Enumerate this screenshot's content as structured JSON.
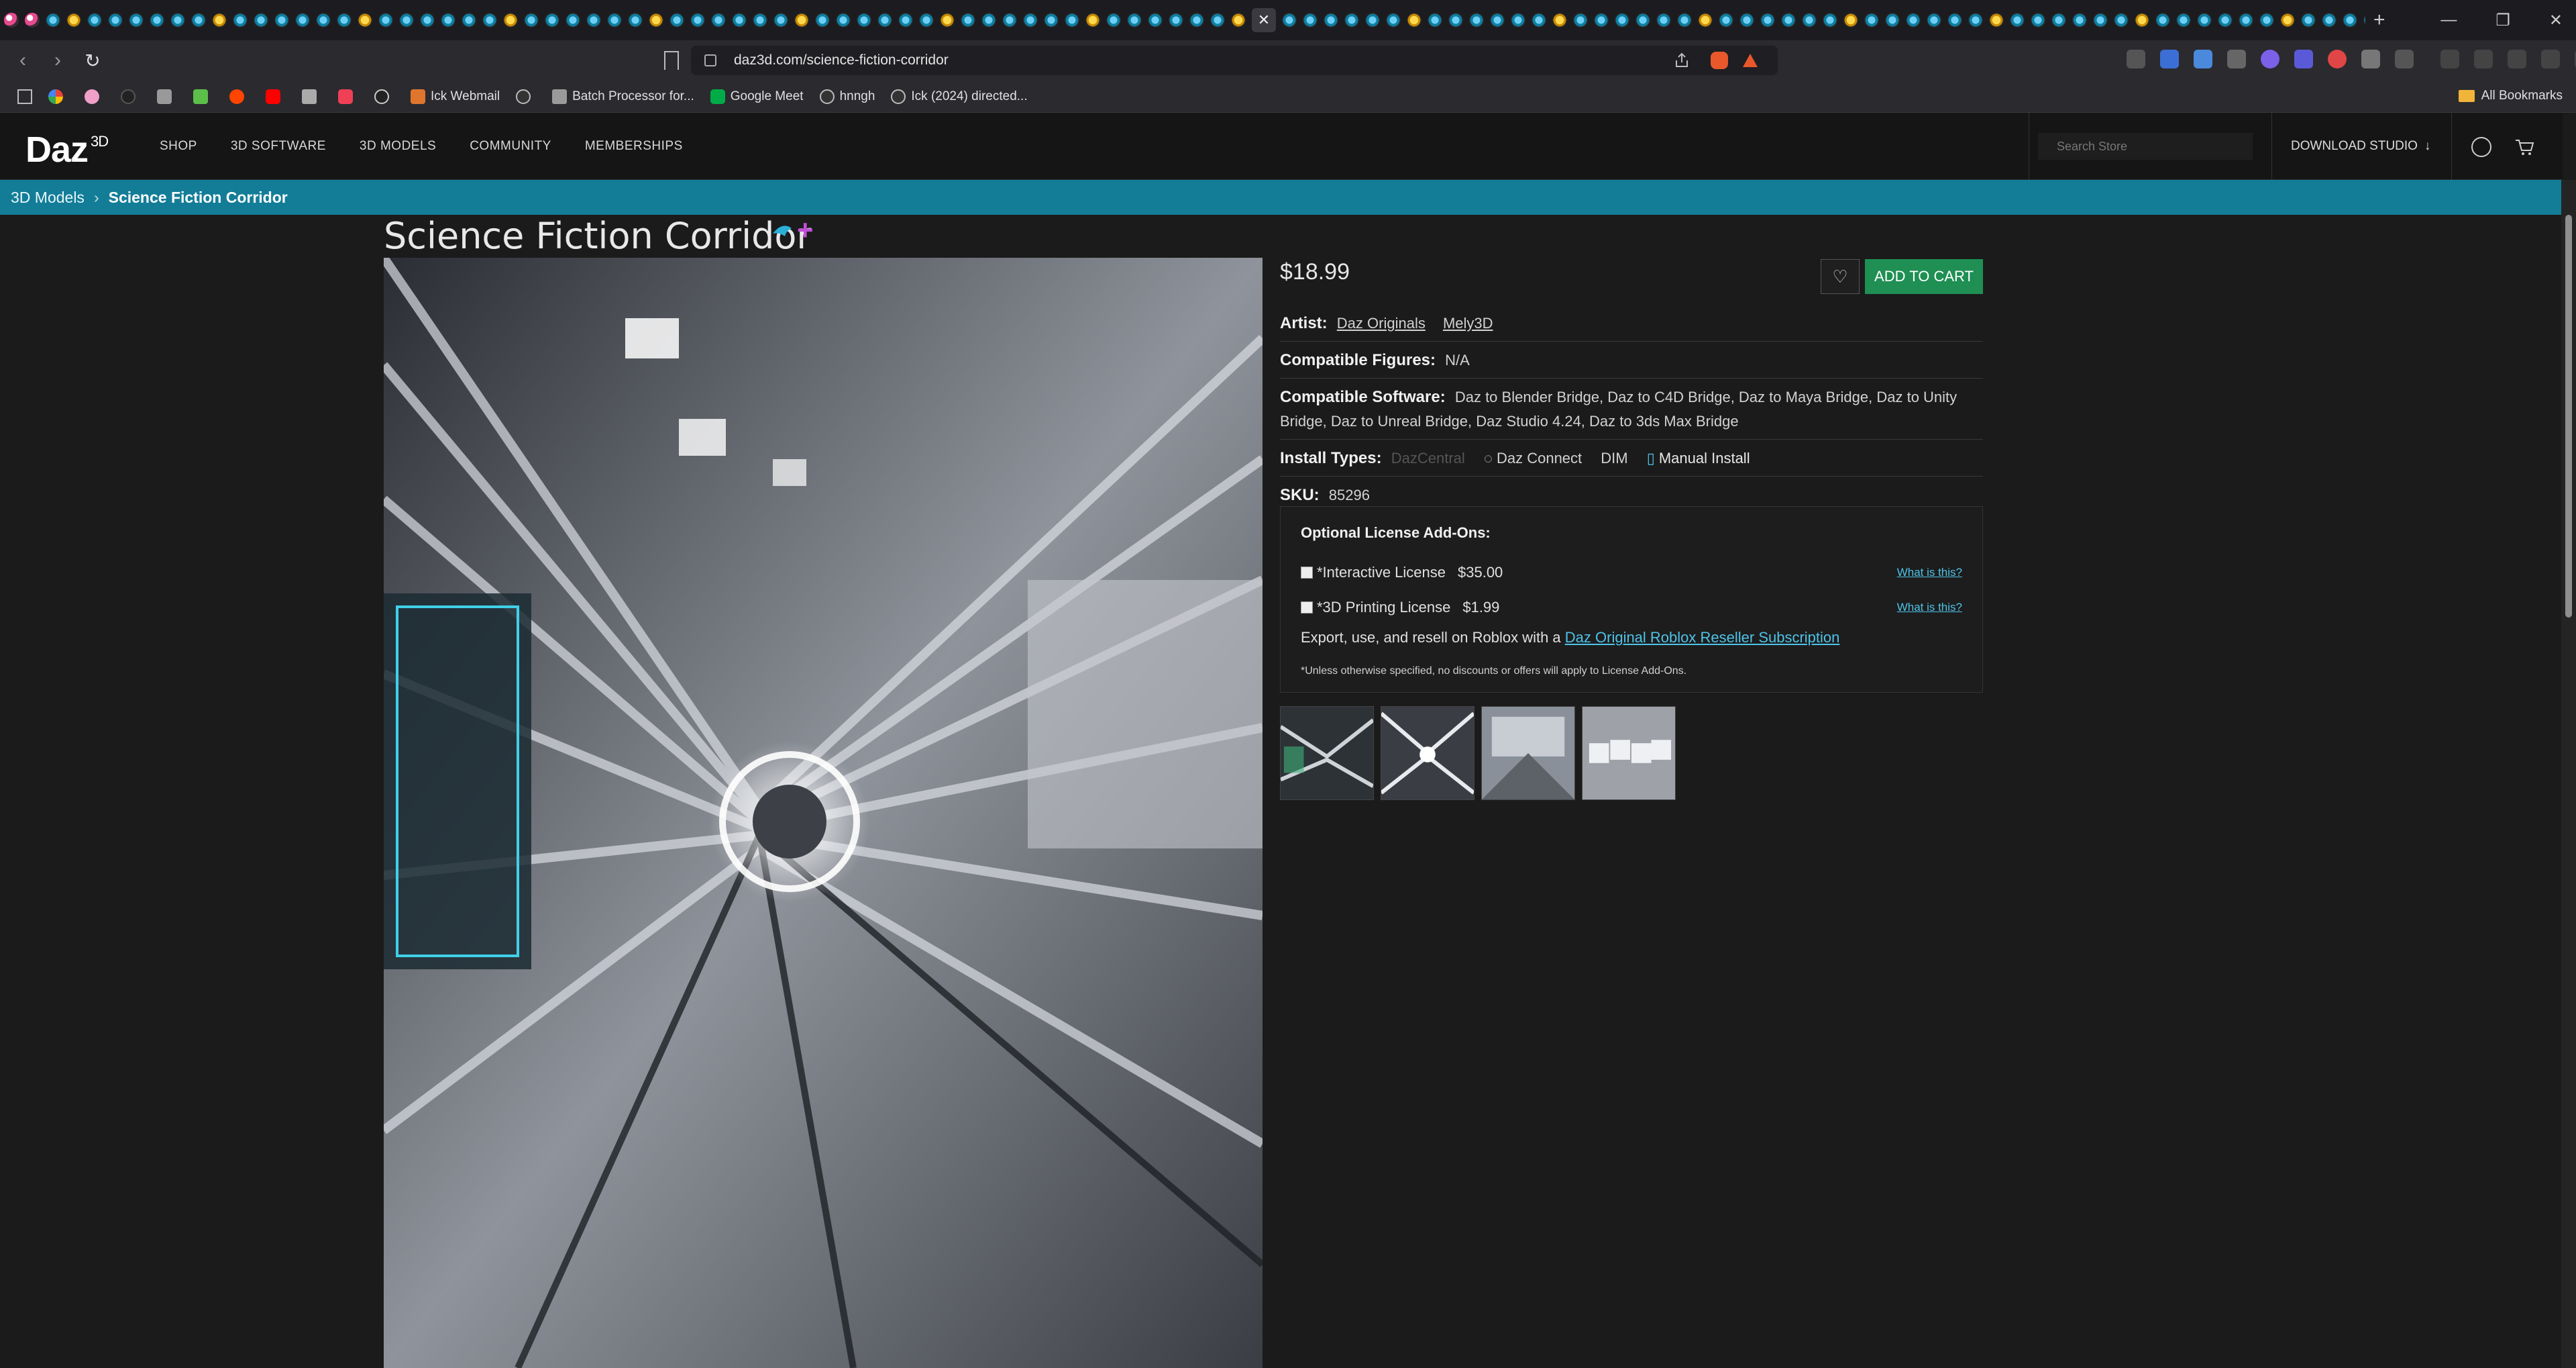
{
  "browser": {
    "url": "daz3d.com/science-fiction-corridor",
    "bookmarks": [
      {
        "label": ""
      },
      {
        "label": ""
      },
      {
        "label": ""
      },
      {
        "label": ""
      },
      {
        "label": ""
      },
      {
        "label": ""
      },
      {
        "label": ""
      },
      {
        "label": ""
      },
      {
        "label": ""
      },
      {
        "label": ""
      },
      {
        "label": "Ick Webmail"
      },
      {
        "label": ""
      },
      {
        "label": "Batch Processor for..."
      },
      {
        "label": "Google Meet"
      },
      {
        "label": "hnngh"
      },
      {
        "label": "Ick (2024) directed..."
      }
    ],
    "all_bookmarks": "All Bookmarks"
  },
  "site": {
    "logo": "Daz",
    "logo_sup": "3D",
    "nav": [
      "SHOP",
      "3D SOFTWARE",
      "3D MODELS",
      "COMMUNITY",
      "MEMBERSHIPS"
    ],
    "search_placeholder": "Search Store",
    "download_studio": "DOWNLOAD STUDIO"
  },
  "breadcrumb": {
    "parent": "3D Models",
    "separator": "›",
    "current": "Science Fiction Corridor"
  },
  "product": {
    "title": "Science Fiction Corridor",
    "price": "$18.99",
    "add_to_cart": "ADD TO CART",
    "artist_label": "Artist:",
    "artists": [
      "Daz Originals",
      "Mely3D"
    ],
    "figures_label": "Compatible Figures:",
    "figures": "N/A",
    "software_label": "Compatible Software:",
    "software": "Daz to Blender Bridge, Daz to C4D Bridge, Daz to Maya Bridge, Daz to Unity Bridge, Daz to Unreal Bridge, Daz Studio 4.24, Daz to 3ds Max Bridge",
    "install_label": "Install Types:",
    "install_types": [
      "DazCentral",
      "Daz Connect",
      "DIM",
      "Manual Install"
    ],
    "sku_label": "SKU:",
    "sku": "85296"
  },
  "addons": {
    "heading": "Optional License Add-Ons:",
    "licenses": [
      {
        "label": "*Interactive License",
        "price": "$35.00",
        "link": "What is this?"
      },
      {
        "label": "*3D Printing License",
        "price": "$1.99",
        "link": "What is this?"
      }
    ],
    "roblox_text": "Export, use, and resell on Roblox with a ",
    "roblox_link": "Daz Original Roblox Reseller Subscription",
    "note": "*Unless otherwise specified, no discounts or offers will apply to License Add-Ons."
  },
  "colors": {
    "accent_bar": "#137d98",
    "cart_button": "#1f8f54",
    "link": "#4ec3e8"
  }
}
